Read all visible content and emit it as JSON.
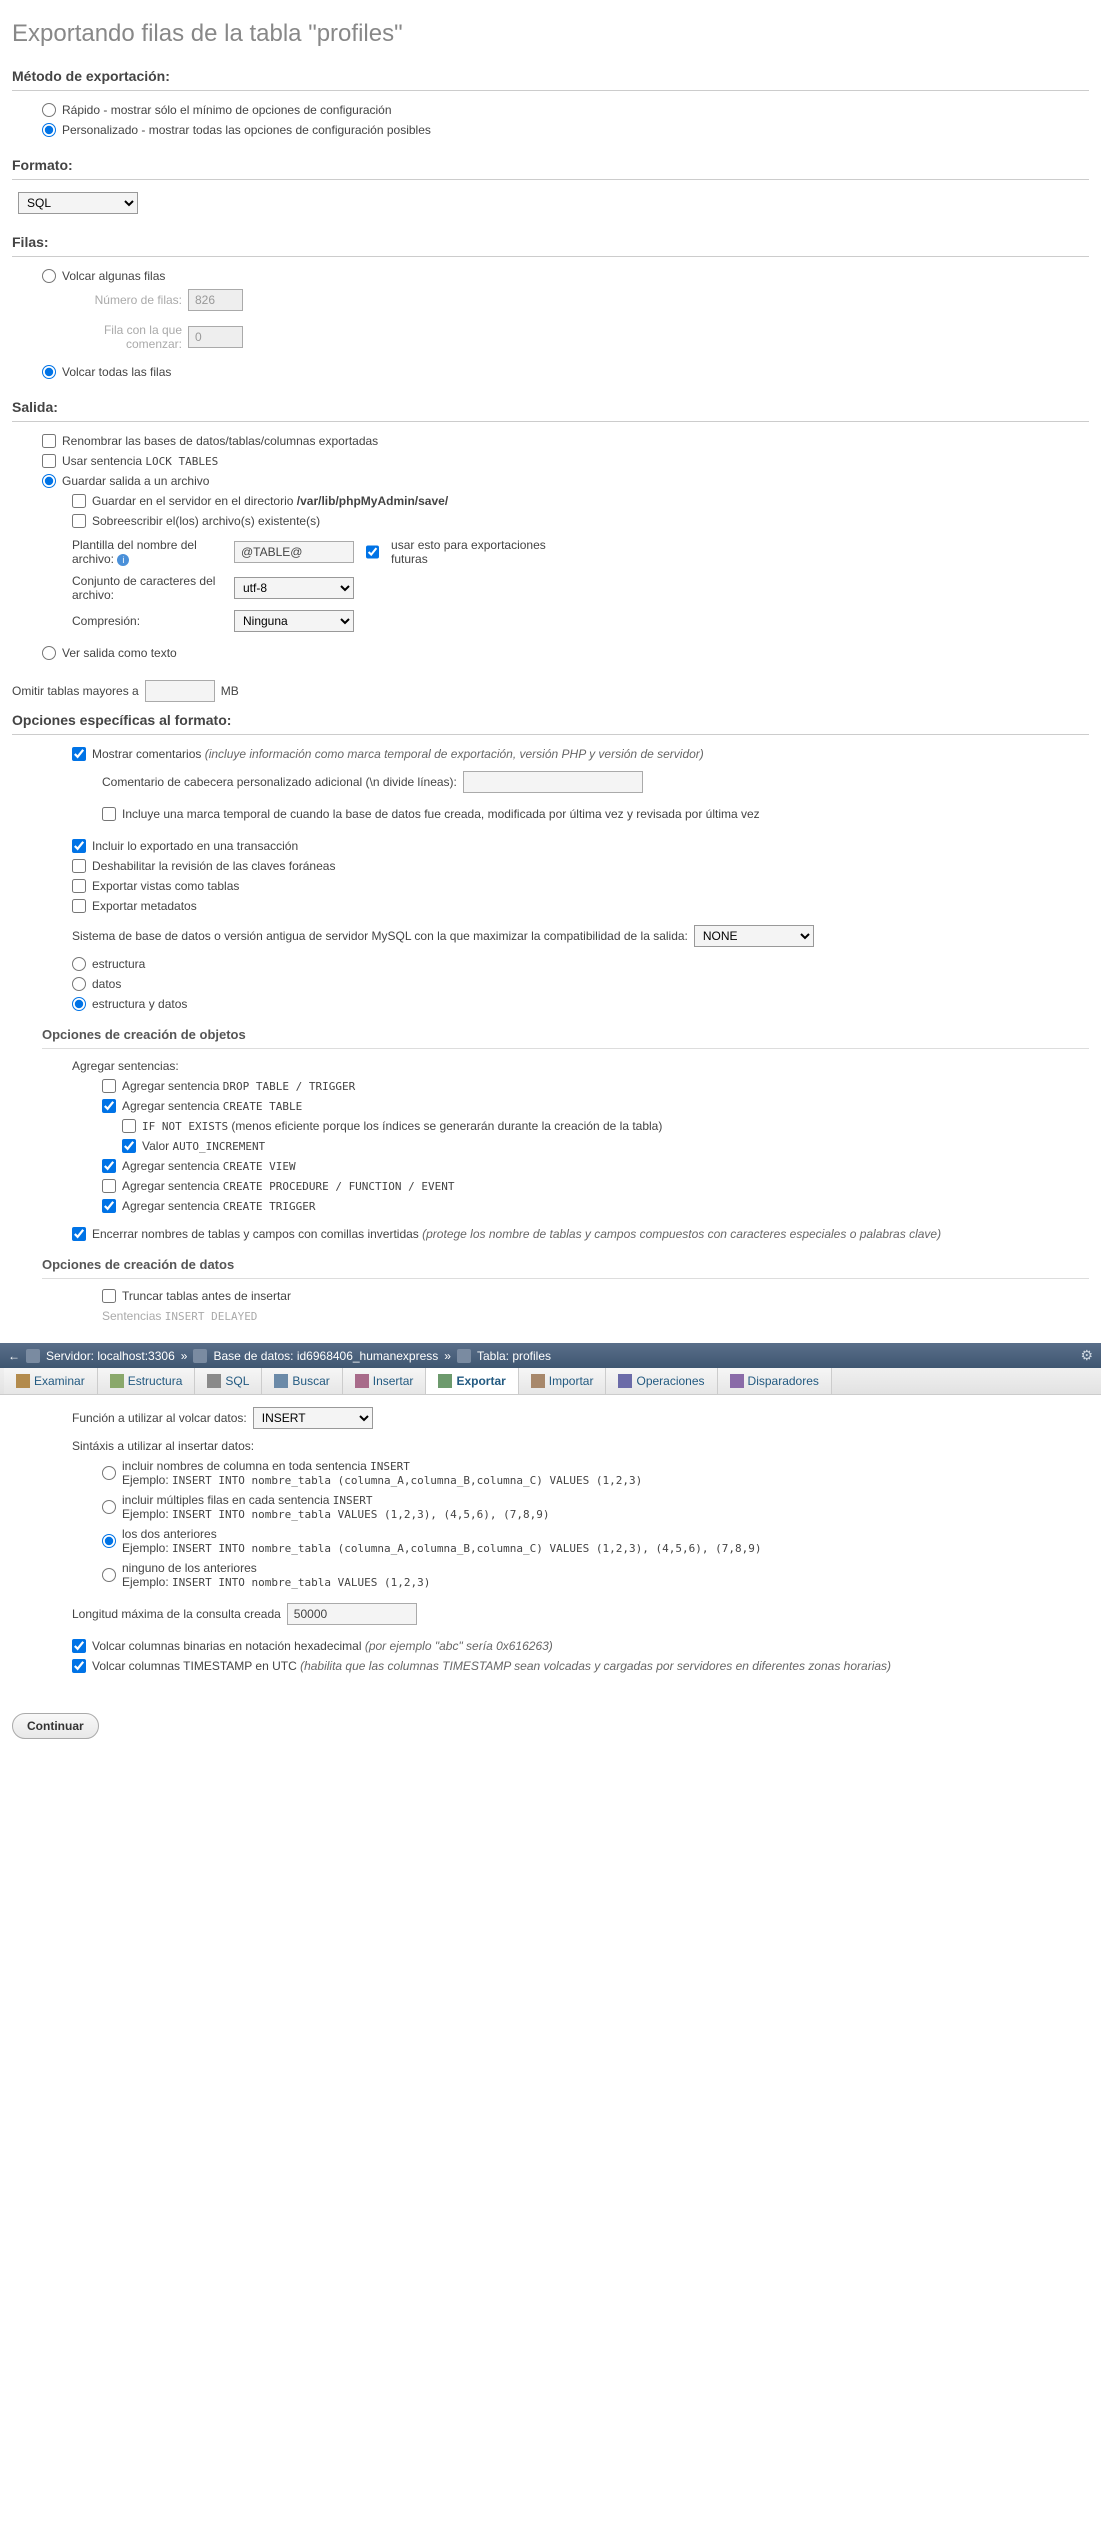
{
  "title": "Exportando filas de la tabla \"profiles\"",
  "method": {
    "header": "Método de exportación:",
    "quick": "Rápido - mostrar sólo el mínimo de opciones de configuración",
    "custom": "Personalizado - mostrar todas las opciones de configuración posibles"
  },
  "format": {
    "header": "Formato:",
    "selected": "SQL"
  },
  "rows": {
    "header": "Filas:",
    "dumpSome": "Volcar algunas filas",
    "numLabel": "Número de filas:",
    "numValue": "826",
    "startLabel": "Fila con la que comenzar:",
    "startValue": "0",
    "dumpAll": "Volcar todas las filas"
  },
  "output": {
    "header": "Salida:",
    "rename": "Renombrar las bases de datos/tablas/columnas exportadas",
    "lockTables": "Usar sentencia ",
    "lockTablesCode": "LOCK TABLES",
    "saveToFile": "Guardar salida a un archivo",
    "saveInDir": "Guardar en el servidor en el directorio ",
    "saveInDirPath": "/var/lib/phpMyAdmin/save/",
    "overwrite": "Sobreescribir el(los) archivo(s) existente(s)",
    "templateLabel": "Plantilla del nombre del archivo:",
    "templateValue": "@TABLE@",
    "useFuture": "usar esto para exportaciones futuras",
    "charsetLabel": "Conjunto de caracteres del archivo:",
    "charsetValue": "utf-8",
    "compressionLabel": "Compresión:",
    "compressionValue": "Ninguna",
    "viewAsText": "Ver salida como texto",
    "skipTablesLabel": "Omitir tablas mayores a",
    "skipTablesUnit": "MB"
  },
  "formatOpts": {
    "header": "Opciones específicas al formato:",
    "showComments": "Mostrar comentarios ",
    "showCommentsNote": "(incluye información como marca temporal de exportación, versión PHP y versión de servidor)",
    "headerComment": "Comentario de cabecera personalizado adicional (\\n divide líneas):",
    "includeTimestamp": "Incluye una marca temporal de cuando la base de datos fue creada, modificada por última vez y revisada por última vez",
    "includeTransaction": "Incluir lo exportado en una transacción",
    "disableFK": "Deshabilitar la revisión de las claves foráneas",
    "exportViews": "Exportar vistas como tablas",
    "exportMetadata": "Exportar metadatos",
    "compatLabel": "Sistema de base de datos o versión antigua de servidor MySQL con la que maximizar la compatibilidad de la salida:",
    "compatValue": "NONE",
    "dumpStruct": "estructura",
    "dumpData": "datos",
    "dumpBoth": "estructura y datos"
  },
  "objCreate": {
    "header": "Opciones de creación de objetos",
    "addStatements": "Agregar sentencias:",
    "dropTable": "Agregar sentencia ",
    "dropTableCode": "DROP TABLE / TRIGGER",
    "createTable": "Agregar sentencia ",
    "createTableCode": "CREATE TABLE",
    "ifNotExistsCode": "IF NOT EXISTS",
    "ifNotExistsNote": " (menos eficiente porque los índices se generarán durante la creación de la tabla)",
    "autoInc": "Valor ",
    "autoIncCode": "AUTO_INCREMENT",
    "createView": "Agregar sentencia ",
    "createViewCode": "CREATE VIEW",
    "createProc": "Agregar sentencia ",
    "createProcCode": "CREATE PROCEDURE / FUNCTION / EVENT",
    "createTrig": "Agregar sentencia ",
    "createTrigCode": "CREATE TRIGGER",
    "backquotes": "Encerrar nombres de tablas y campos con comillas invertidas ",
    "backquotesNote": "(protege los nombre de tablas y campos compuestos con caracteres especiales o palabras clave)"
  },
  "dataCreate": {
    "header": "Opciones de creación de datos",
    "truncate": "Truncar tablas antes de insertar",
    "delayed": "Sentencias ",
    "delayedCode": "INSERT DELAYED"
  },
  "breadcrumb": {
    "back": "←",
    "server": "Servidor: localhost:3306",
    "sep": "»",
    "db": "Base de datos: id6968406_humanexpress",
    "table": "Tabla: profiles"
  },
  "tabs": {
    "browse": "Examinar",
    "structure": "Estructura",
    "sql": "SQL",
    "search": "Buscar",
    "insert": "Insertar",
    "export": "Exportar",
    "import": "Importar",
    "operations": "Operaciones",
    "triggers": "Disparadores"
  },
  "dataOpts": {
    "funcLabel": "Función a utilizar al volcar datos:",
    "funcValue": "INSERT",
    "syntaxLabel": "Sintáxis a utilizar al insertar datos:",
    "opt1": "incluir nombres de columna en toda sentencia ",
    "opt1Code": "INSERT",
    "opt1Ex": "Ejemplo: ",
    "opt1ExCode": "INSERT INTO nombre_tabla (columna_A,columna_B,columna_C) VALUES (1,2,3)",
    "opt2": "incluir múltiples filas en cada sentencia ",
    "opt2Code": "INSERT",
    "opt2Ex": "Ejemplo: ",
    "opt2ExCode": "INSERT INTO nombre_tabla VALUES (1,2,3), (4,5,6), (7,8,9)",
    "opt3": "los dos anteriores",
    "opt3Ex": "Ejemplo: ",
    "opt3ExCode": "INSERT INTO nombre_tabla (columna_A,columna_B,columna_C) VALUES (1,2,3), (4,5,6), (7,8,9)",
    "opt4": "ninguno de los anteriores",
    "opt4Ex": "Ejemplo: ",
    "opt4ExCode": "INSERT INTO nombre_tabla VALUES (1,2,3)",
    "maxLenLabel": "Longitud máxima de la consulta creada",
    "maxLenValue": "50000",
    "binaryHex": "Volcar columnas binarias en notación hexadecimal ",
    "binaryHexNote": "(por ejemplo \"abc\" sería 0x616263)",
    "tsUtc": "Volcar columnas TIMESTAMP en UTC ",
    "tsUtcNote": "(habilita que las columnas TIMESTAMP sean volcadas y cargadas por servidores en diferentes zonas horarias)"
  },
  "continue": "Continuar"
}
